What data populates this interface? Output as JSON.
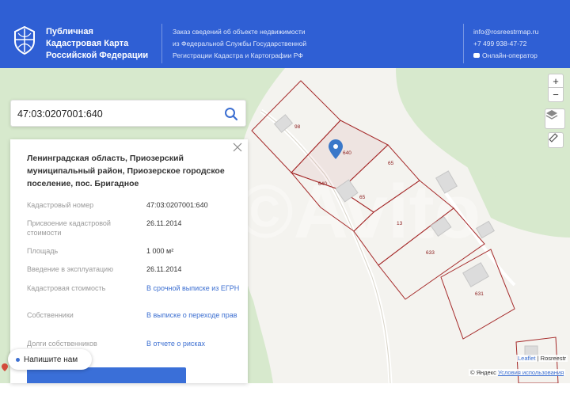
{
  "header": {
    "brand_lines": [
      "Публичная",
      "Кадастровая Карта",
      "Российской Федерации"
    ],
    "service_lines": [
      "Заказ сведений об объекте недвижимости",
      "из Федеральной Службы Государственной",
      "Регистрации Кадастра и Картографии РФ"
    ],
    "email": "info@rosreestrmap.ru",
    "phone": "+7 499 938-47-72",
    "operator": "Онлайн-оператор"
  },
  "search": {
    "value": "47:03:0207001:640",
    "icon": "search-icon"
  },
  "panel": {
    "address": "Ленинградская область, Приозерский муниципальный район, Приозерское городское поселение, пос. Бригадное",
    "rows": [
      {
        "label": "Кадастровый номер",
        "value": "47:03:0207001:640",
        "link": false
      },
      {
        "label": "Присвоение кадастровой стоимости",
        "value": "26.11.2014",
        "link": false
      },
      {
        "label": "Площадь",
        "value": "1 000 м²",
        "link": false
      },
      {
        "label": "Введение в эксплуатацию",
        "value": "26.11.2014",
        "link": false
      },
      {
        "label": "Кадастровая стоимость",
        "value": "В срочной выписке из ЕГРН",
        "link": true
      },
      {
        "label": "Собственники",
        "value": "В выписке о переходе прав",
        "link": true
      },
      {
        "label": "Долги собственников",
        "value": "В отчете о рисках",
        "link": true
      }
    ]
  },
  "chat": {
    "label": "Напишите нам"
  },
  "map": {
    "zoom_in": "+",
    "zoom_out": "−",
    "plots": [
      "98",
      "640",
      "65",
      "640",
      "65",
      "13",
      "633",
      "631"
    ],
    "watermark": "©Avito"
  },
  "attribution": {
    "leaflet": "Leaflet",
    "rosreestr": "Rosreestr",
    "yandex": "© Яндекс",
    "terms": "Условия использования"
  },
  "colors": {
    "header_bg": "#2f5fd4",
    "plot_border": "#a52a2a",
    "link": "#3c6fd1",
    "green_area": "#d7e9cd"
  }
}
